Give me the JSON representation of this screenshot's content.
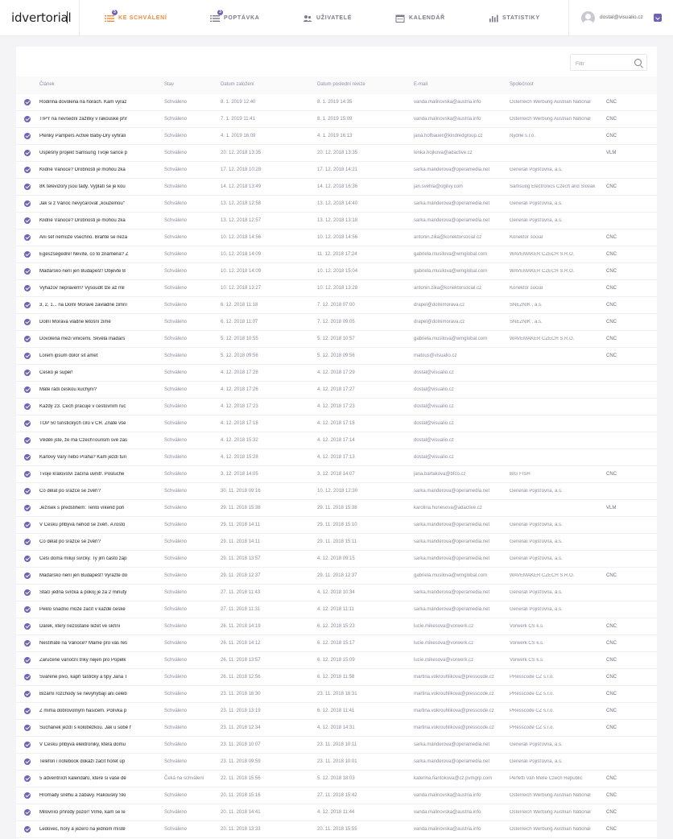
{
  "app": {
    "logo": "idvertorial"
  },
  "nav": [
    {
      "label": "KE SCHVÁLENÍ",
      "icon": "list-icon",
      "badge": "5",
      "active": true
    },
    {
      "label": "POPTÁVKA",
      "icon": "list-icon",
      "badge": "3",
      "active": false
    },
    {
      "label": "UŽIVATELÉ",
      "icon": "users-icon",
      "badge": null,
      "active": false
    },
    {
      "label": "KALENDÁŘ",
      "icon": "calendar-icon",
      "badge": null,
      "active": false
    },
    {
      "label": "STATISTIKY",
      "icon": "bar-chart-icon",
      "badge": null,
      "active": false
    }
  ],
  "user": {
    "email": "dostal@visualio.cz"
  },
  "filter": {
    "placeholder": "Filtr",
    "value": ""
  },
  "columns": {
    "article": "Článek",
    "status": "Stav",
    "created": "Datum založení",
    "revised": "Datum poslední revize",
    "email": "E-mail",
    "company": "Společnost"
  },
  "rows": [
    {
      "title": "Rodinná dovolená na horách. Kam vyraz",
      "status": "Schváleno",
      "created": "8. 1. 2019 12:40",
      "revised": "8. 1. 2019 14:35",
      "email": "vanda.malinovska@austria.info",
      "company": "Österreich Werbung Austrian National",
      "tag": "CNC"
    },
    {
      "title": "TIPY na nevšední zážitky v rakouské přír",
      "status": "Schváleno",
      "created": "7. 1. 2019 11:41",
      "revised": "8. 1. 2019 15:09",
      "email": "vanda.malinovska@austria.info",
      "company": "Österreich Werbung Austrian National",
      "tag": "CNC"
    },
    {
      "title": "Plenky Pampers Active Baby-Dry vyhráli",
      "status": "Schváleno",
      "created": "4. 1. 2019 16:09",
      "revised": "4. 1. 2019 16:13",
      "email": "jana.hofbauer@kindredgroup.cz",
      "company": "Nydrle s.r.o.",
      "tag": "CNC"
    },
    {
      "title": "Úspěšný projekt Samsung Tvoje šance p",
      "status": "Schváleno",
      "created": "20. 12. 2018 13:35",
      "revised": "20. 12. 2018 13:35",
      "email": "lenka.hojkova@adactive.cz",
      "company": "",
      "tag": "VLM"
    },
    {
      "title": "Klidné Vánoce? Drobnosti je mohou zka",
      "status": "Schváleno",
      "created": "17. 12. 2018 10:28",
      "revised": "17. 12. 2018 14:21",
      "email": "sarka.manderova@operamedia.net",
      "company": "Generali Pojišťovna, a.s.",
      "tag": ""
    },
    {
      "title": "8K televizory jsou tady. Vyplatí se je kou",
      "status": "Schváleno",
      "created": "14. 12. 2018 13:49",
      "revised": "14. 12. 2018 16:36",
      "email": "jan.svehla@ogilvy.com",
      "company": "Samsung Electronics Czech and Slovak",
      "tag": "CNC"
    },
    {
      "title": "Jak si z Vánoc nevyčarovat „kouzelnou“",
      "status": "Schváleno",
      "created": "13. 12. 2018 12:58",
      "revised": "13. 12. 2018 14:40",
      "email": "sarka.manderova@operamedia.net",
      "company": "Generali Pojišťovna, a.s.",
      "tag": ""
    },
    {
      "title": "Klidné Vánoce? Drobnosti je mohou zka",
      "status": "Schváleno",
      "created": "13. 12. 2018 12:57",
      "revised": "13. 12. 2018 13:18",
      "email": "sarka.manderova@operamedia.net",
      "company": "Generali Pojišťovna, a.s.",
      "tag": ""
    },
    {
      "title": "Ani šéf nemůže všechno. Braňte se neza",
      "status": "Schváleno",
      "created": "10. 12. 2018 14:56",
      "revised": "10. 12. 2018 14:56",
      "email": "antonin.zika@konektorsocial.cz",
      "company": "Konektor social",
      "tag": "CNC"
    },
    {
      "title": "Egészségedre! Nevíte, co to znamená? Z",
      "status": "Schváleno",
      "created": "10. 12. 2018 14:09",
      "revised": "11. 12. 2018 17:24",
      "email": "gabriela.musilova@wmglobal.com",
      "company": "WAVEMAKER CZECH S.R.O.",
      "tag": "CNC"
    },
    {
      "title": "Maďarsko není jen Budapešť! Objevte B",
      "status": "Schváleno",
      "created": "10. 12. 2018 14:09",
      "revised": "10. 12. 2018 15:04",
      "email": "gabriela.musilova@wmglobal.com",
      "company": "WAVEMAKER CZECH S.R.O.",
      "tag": "CNC"
    },
    {
      "title": "Vyhazov neprávem? Vysoudit lze až mil",
      "status": "Schváleno",
      "created": "10. 12. 2018 13:27",
      "revised": "10. 12. 2018 13:28",
      "email": "antonin.zika@konektorsocial.cz",
      "company": "Konektor social",
      "tag": "CNC"
    },
    {
      "title": "3, 2, 1... na Dolní Moravě zavládne zimní",
      "status": "Schváleno",
      "created": "6. 12. 2018 11:18",
      "revised": "7. 12. 2018 07:00",
      "email": "drapel@dolnimorava.cz",
      "company": "SNĚŽNÍK , a.s.",
      "tag": "CNC"
    },
    {
      "title": "Dolní Morava vládne letošní zimě",
      "status": "Schváleno",
      "created": "6. 12. 2018 11:07",
      "revised": "7. 12. 2018 09:05",
      "email": "drapel@dolnimorava.cz",
      "company": "SNĚŽNÍK , a.s.",
      "tag": "CNC"
    },
    {
      "title": "Dovolená mezi vinicemi. Skvělá maďars",
      "status": "Schváleno",
      "created": "5. 12. 2018 10:55",
      "revised": "5. 12. 2018 10:57",
      "email": "gabriela.musilova@wmglobal.com",
      "company": "WAVEMAKER CZECH S.R.O.",
      "tag": "CNC"
    },
    {
      "title": "Lorem ipsum dolor sit amet",
      "status": "Schváleno",
      "created": "5. 12. 2018 09:56",
      "revised": "5. 12. 2018 09:56",
      "email": "matous@visualio.cz",
      "company": "",
      "tag": "CNC"
    },
    {
      "title": "Česko je super!",
      "status": "Schváleno",
      "created": "4. 12. 2018 17:28",
      "revised": "4. 12. 2018 17:29",
      "email": "dostal@visualio.cz",
      "company": "",
      "tag": ""
    },
    {
      "title": "Máte rádi českou kuchyni?",
      "status": "Schváleno",
      "created": "4. 12. 2018 17:26",
      "revised": "4. 12. 2018 17:27",
      "email": "dostal@visualio.cz",
      "company": "",
      "tag": ""
    },
    {
      "title": "Každý 23. Čech pracuje v cestovním ruc",
      "status": "Schváleno",
      "created": "4. 12. 2018 17:23",
      "revised": "4. 12. 2018 17:23",
      "email": "dostal@visualio.cz",
      "company": "",
      "tag": ""
    },
    {
      "title": "TOP 50 turistických cílů v ČR. Znáte vše",
      "status": "Schváleno",
      "created": "4. 12. 2018 17:18",
      "revised": "4. 12. 2018 17:18",
      "email": "dostal@visualio.cz",
      "company": "",
      "tag": ""
    },
    {
      "title": "Věděli jste, že má CzechTourism své zas",
      "status": "Schváleno",
      "created": "4. 12. 2018 15:32",
      "revised": "4. 12. 2018 17:14",
      "email": "dostal@visualio.cz",
      "company": "",
      "tag": ""
    },
    {
      "title": "Karlovy Vary nebo Praha? Kam jezdí turi",
      "status": "Schváleno",
      "created": "4. 12. 2018 15:28",
      "revised": "4. 12. 2018 17:13",
      "email": "dostal@visualio.cz",
      "company": "",
      "tag": ""
    },
    {
      "title": "Tvoje království začíná uvnitř. Posluche",
      "status": "Schváleno",
      "created": "3. 12. 2018 14:05",
      "revised": "3. 12. 2018 14:07",
      "email": "jana.bartakova@bfco.cz",
      "company": "BIG FISH",
      "tag": "CNC"
    },
    {
      "title": "Co dělat po srážce se zvěří?",
      "status": "Schváleno",
      "created": "30. 11. 2018 09:16",
      "revised": "10. 12. 2018 12:30",
      "email": "sarka.manderova@operamedia.net",
      "company": "Generali Pojišťovna, a.s.",
      "tag": ""
    },
    {
      "title": "Ježíšek s předstihem: Tento víkend poři",
      "status": "Schváleno",
      "created": "29. 11. 2018 15:38",
      "revised": "29. 11. 2018 15:38",
      "email": "karolina.hunesova@adactive.cz",
      "company": "",
      "tag": "VLM"
    },
    {
      "title": "V Česku přibývá nehod se zvěří. A rosto",
      "status": "Schváleno",
      "created": "29. 11. 2018 14:11",
      "revised": "29. 11. 2018 15:10",
      "email": "sarka.manderova@operamedia.net",
      "company": "Generali Pojišťovna, a.s.",
      "tag": ""
    },
    {
      "title": "Co dělat po srážce se zvěří?",
      "status": "Schváleno",
      "created": "29. 11. 2018 14:11",
      "revised": "29. 11. 2018 15:11",
      "email": "sarka.manderova@operamedia.net",
      "company": "Generali Pojišťovna, a.s.",
      "tag": ""
    },
    {
      "title": "Češi doma milují svíčky. Ty jim často zap",
      "status": "Schváleno",
      "created": "29. 11. 2018 13:57",
      "revised": "4. 12. 2018 09:15",
      "email": "sarka.manderova@operamedia.net",
      "company": "Generali Pojišťovna, a.s.",
      "tag": ""
    },
    {
      "title": "Maďarsko není jen Budapešť! Vyrazte do",
      "status": "Schváleno",
      "created": "29. 11. 2018 12:37",
      "revised": "29. 11. 2018 12:37",
      "email": "gabriela.musilova@wmglobal.com",
      "company": "WAVEMAKER CZECH S.R.O.",
      "tag": "CNC"
    },
    {
      "title": "Stačí jedna svíčka a pokoj je za 2 minuty",
      "status": "Schváleno",
      "created": "27. 11. 2018 11:43",
      "revised": "4. 12. 2018 10:34",
      "email": "sarka.manderova@operamedia.net",
      "company": "Generali Pojišťovna, a.s.",
      "tag": ""
    },
    {
      "title": "Peklo snadno může začít v každé české",
      "status": "Schváleno",
      "created": "27. 11. 2018 11:31",
      "revised": "4. 12. 2018 11:11",
      "email": "sarka.manderova@operamedia.net",
      "company": "Generali Pojišťovna, a.s.",
      "tag": ""
    },
    {
      "title": "Dárek, který nezůstane ležet ve skříni",
      "status": "Schváleno",
      "created": "26. 11. 2018 14:19",
      "revised": "6. 12. 2018 15:23",
      "email": "lucie.mikesova@vorwerk.cz",
      "company": "Vorwerk CS k.s.",
      "tag": "CNC"
    },
    {
      "title": "Nestíháte na Vánoce? Máme pro vás řeš",
      "status": "Schváleno",
      "created": "26. 11. 2018 14:12",
      "revised": "6. 12. 2018 15:17",
      "email": "lucie.mikesova@vorwerk.cz",
      "company": "Vorwerk CS k.s.",
      "tag": "CNC"
    },
    {
      "title": "Zaručené vánoční triky nejen pro Popelk",
      "status": "Schváleno",
      "created": "26. 11. 2018 13:57",
      "revised": "6. 12. 2018 15:09",
      "email": "lucie.mikesova@vorwerk.cz",
      "company": "Vorwerk CS k.s.",
      "tag": "CNC"
    },
    {
      "title": "Svařené pivo, kapří taštičky a tipy Jana T",
      "status": "Schváleno",
      "created": "26. 11. 2018 12:56",
      "revised": "6. 12. 2018 11:58",
      "email": "martina.vokrouhlikova@presscode.cz",
      "company": "PResscode CZ s.r.o.",
      "tag": "CNC"
    },
    {
      "title": "Bizarní rozchody se nevyhýbají ani celeb",
      "status": "Schváleno",
      "created": "23. 11. 2018 16:30",
      "revised": "23. 11. 2018 16:31",
      "email": "martina.vokrouhlikova@presscode.cz",
      "company": "PResscode CZ s.r.o.",
      "tag": "CNC"
    },
    {
      "title": "Z mima dobrovolným hasičem. Polívka p",
      "status": "Schváleno",
      "created": "23. 11. 2018 13:19",
      "revised": "6. 12. 2018 11:41",
      "email": "martina.vokrouhlikova@presscode.cz",
      "company": "PResscode CZ s.r.o.",
      "tag": "CNC"
    },
    {
      "title": "Suchánek jezdí s koloběžkou. Jak u sobě he",
      "status": "Schváleno",
      "created": "23. 11. 2018 12:34",
      "revised": "4. 12. 2018 14:31",
      "email": "martina.vokrouhlikova@presscode.cz",
      "company": "PResscode CZ s.r.o.",
      "tag": "CNC"
    },
    {
      "title": "V Česku přibývá elektroniky, která domu",
      "status": "Schváleno",
      "created": "23. 11. 2018 10:07",
      "revised": "23. 11. 2018 10:11",
      "email": "sarka.manderova@operamedia.net",
      "company": "Generali Pojišťovna, a.s.",
      "tag": ""
    },
    {
      "title": "Telefon i notebook dokáží začít hořet úp",
      "status": "Schváleno",
      "created": "23. 11. 2018 09:59",
      "revised": "23. 11. 2018 10:01",
      "email": "sarka.manderova@operamedia.net",
      "company": "Generali Pojišťovna, a.s.",
      "tag": ""
    },
    {
      "title": "5 adventních kalendářů, které si vaše dě",
      "status": "Čeká na schválení",
      "created": "22. 11. 2018 15:56",
      "revised": "5. 12. 2018 18:03",
      "email": "katerina.fiantokova@cz.pvmgrp.com",
      "company": "Perfetti Van Melle Czech Republic",
      "tag": "CNC"
    },
    {
      "title": "Hromady sněhu a zábavy. Rakouský Ski",
      "status": "Schváleno",
      "created": "20. 11. 2018 15:16",
      "revised": "27. 11. 2018 15:42",
      "email": "vanda.malinovska@austria.info",
      "company": "Österreich Werbung Austrian National",
      "tag": "CNC"
    },
    {
      "title": "Milovníci přírody pozor! Víme, kam se le",
      "status": "Schváleno",
      "created": "20. 11. 2018 14:41",
      "revised": "4. 12. 2018 11:44",
      "email": "vanda.malinovska@austria.info",
      "company": "Österreich Werbung Austrian National",
      "tag": "CNC"
    },
    {
      "title": "Ledovec, hory a jezero na jednom místě",
      "status": "Schváleno",
      "created": "20. 11. 2018 13:33",
      "revised": "20. 11. 2018 15:55",
      "email": "vanda.malinovska@austria.info",
      "company": "Österreich Werbung Austrian National",
      "tag": "CNC"
    }
  ]
}
